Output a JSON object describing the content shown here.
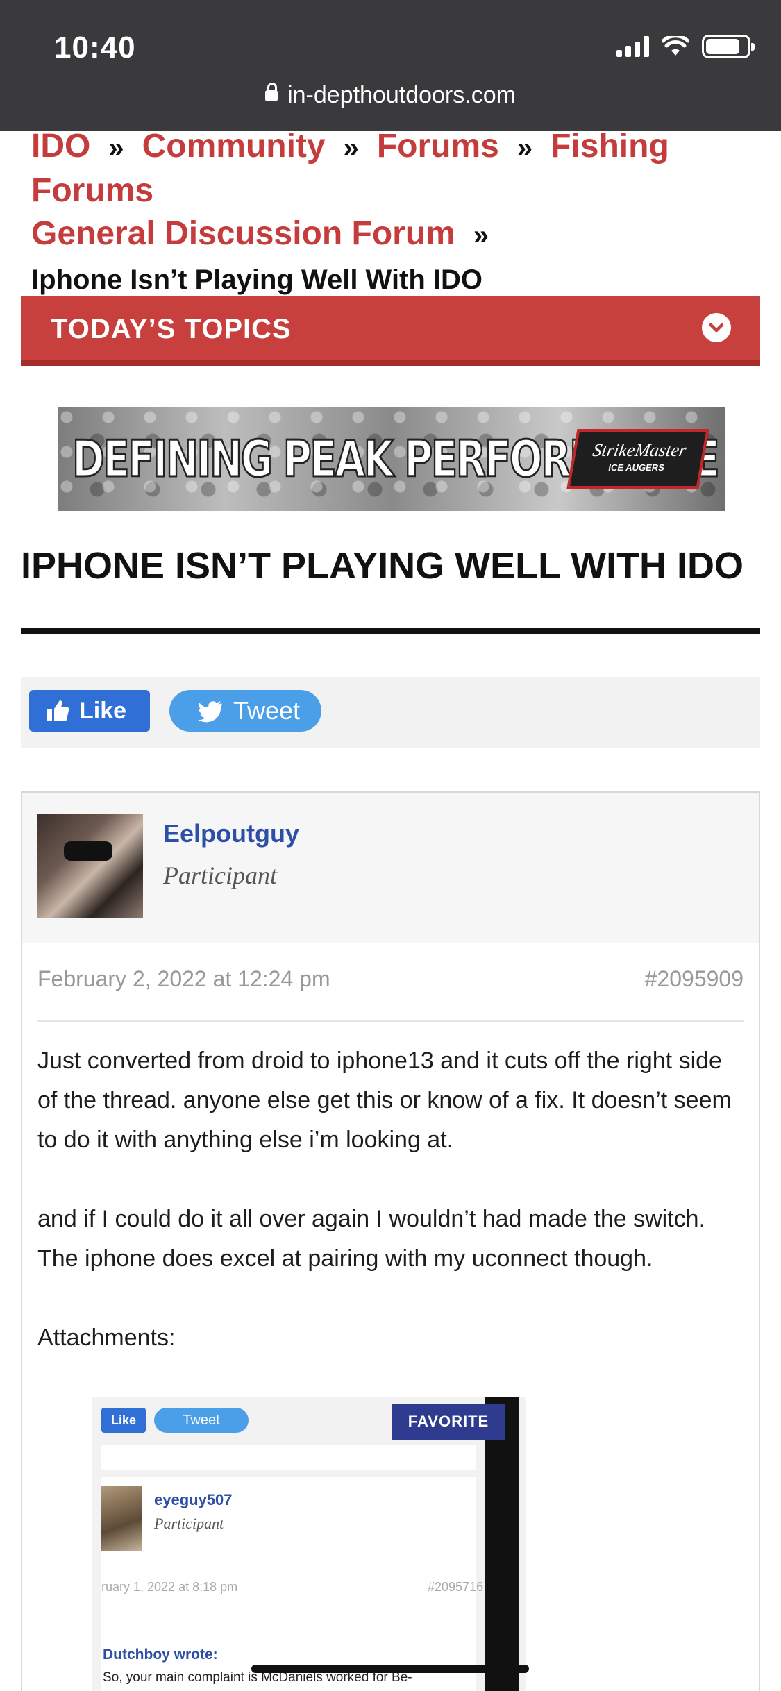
{
  "status_bar": {
    "time": "10:40",
    "url": "in-depthoutdoors.com"
  },
  "breadcrumb": {
    "items": [
      "IDO",
      "Community",
      "Forums",
      "Fishing Forums",
      "General Discussion Forum"
    ],
    "separator": "»",
    "current": "Iphone Isn’t Playing Well With IDO"
  },
  "topics": {
    "label": "TODAY’S TOPICS"
  },
  "banner": {
    "headline": "DEFINING PEAK PERFORMANCE",
    "brand": "StrikeMaster",
    "brand_sub": "ICE AUGERS"
  },
  "thread": {
    "title": "IPHONE ISN’T PLAYING WELL WITH IDO"
  },
  "social": {
    "like_label": "Like",
    "tweet_label": "Tweet"
  },
  "post": {
    "author": "Eelpoutguy",
    "role": "Participant",
    "date": "February 2, 2022 at 12:24 pm",
    "id": "#2095909",
    "paragraph1": "Just converted from droid to iphone13 and it cuts off the right side of the thread. anyone else get this or know of a fix. It doesn’t seem to do it with anything else i’m looking at.",
    "paragraph2": "and if I could do it all over again I wouldn’t had made the switch. The iphone does excel at pairing with my uconnect though.",
    "attachments_label": "Attachments:"
  },
  "attachment": {
    "like_label": "Like",
    "tweet_label": "Tweet",
    "favorite_label": "FAVORITE",
    "author": "eyeguy507",
    "role": "Participant",
    "date": "ruary 1, 2022 at 8:18 pm",
    "id": "#2095716",
    "quote_name": "Dutchboy wrote:",
    "quote_text": "So, your main complaint is McDaniels worked for Be-"
  },
  "colors": {
    "brand_red": "#c8403d",
    "link_blue": "#2e4fa6",
    "like_blue": "#2f6fd6",
    "tweet_blue": "#4a9fe8"
  }
}
